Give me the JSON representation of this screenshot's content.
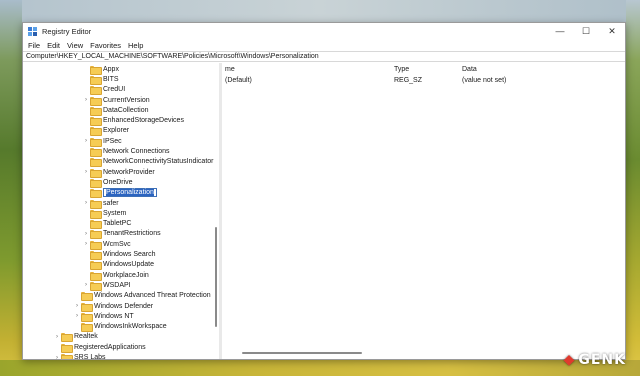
{
  "window": {
    "title": "Registry Editor",
    "controls": {
      "minimize": "—",
      "maximize": "☐",
      "close": "✕"
    }
  },
  "menu": [
    "File",
    "Edit",
    "View",
    "Favorites",
    "Help"
  ],
  "address": "Computer\\HKEY_LOCAL_MACHINE\\SOFTWARE\\Policies\\Microsoft\\Windows\\Personalization",
  "tree": [
    {
      "label": "Appx",
      "level": 2,
      "expandable": false
    },
    {
      "label": "BITS",
      "level": 2,
      "expandable": false
    },
    {
      "label": "CredUI",
      "level": 2,
      "expandable": false
    },
    {
      "label": "CurrentVersion",
      "level": 2,
      "expandable": true
    },
    {
      "label": "DataCollection",
      "level": 2,
      "expandable": false
    },
    {
      "label": "EnhancedStorageDevices",
      "level": 2,
      "expandable": false
    },
    {
      "label": "Explorer",
      "level": 2,
      "expandable": false
    },
    {
      "label": "IPSec",
      "level": 2,
      "expandable": true
    },
    {
      "label": "Network Connections",
      "level": 2,
      "expandable": false
    },
    {
      "label": "NetworkConnectivityStatusIndicator",
      "level": 2,
      "expandable": false
    },
    {
      "label": "NetworkProvider",
      "level": 2,
      "expandable": true
    },
    {
      "label": "OneDrive",
      "level": 2,
      "expandable": false
    },
    {
      "label": "Personalization",
      "level": 2,
      "expandable": false,
      "editing": true
    },
    {
      "label": "safer",
      "level": 2,
      "expandable": true
    },
    {
      "label": "System",
      "level": 2,
      "expandable": false
    },
    {
      "label": "TabletPC",
      "level": 2,
      "expandable": false
    },
    {
      "label": "TenantRestrictions",
      "level": 2,
      "expandable": true
    },
    {
      "label": "WcmSvc",
      "level": 2,
      "expandable": true
    },
    {
      "label": "Windows Search",
      "level": 2,
      "expandable": false
    },
    {
      "label": "WindowsUpdate",
      "level": 2,
      "expandable": false
    },
    {
      "label": "WorkplaceJoin",
      "level": 2,
      "expandable": false
    },
    {
      "label": "WSDAPI",
      "level": 2,
      "expandable": true
    },
    {
      "label": "Windows Advanced Threat Protection",
      "level": 1,
      "expandable": false
    },
    {
      "label": "Windows Defender",
      "level": 1,
      "expandable": true
    },
    {
      "label": "Windows NT",
      "level": 1,
      "expandable": true
    },
    {
      "label": "WindowsInkWorkspace",
      "level": 1,
      "expandable": false
    },
    {
      "label": "Realtek",
      "level": 0,
      "expandable": true
    },
    {
      "label": "RegisteredApplications",
      "level": 0,
      "expandable": false
    },
    {
      "label": "SRS Labs",
      "level": 0,
      "expandable": true
    }
  ],
  "values": {
    "headers": {
      "name": "me",
      "type": "Type",
      "data": "Data"
    },
    "rows": [
      {
        "name": "(Default)",
        "type": "REG_SZ",
        "data": "(value not set)"
      }
    ]
  },
  "watermark": "GENK",
  "colors": {
    "folder": "#f6cc55",
    "selection": "#2b64c0",
    "watermark_mark": "#e03a2e"
  }
}
